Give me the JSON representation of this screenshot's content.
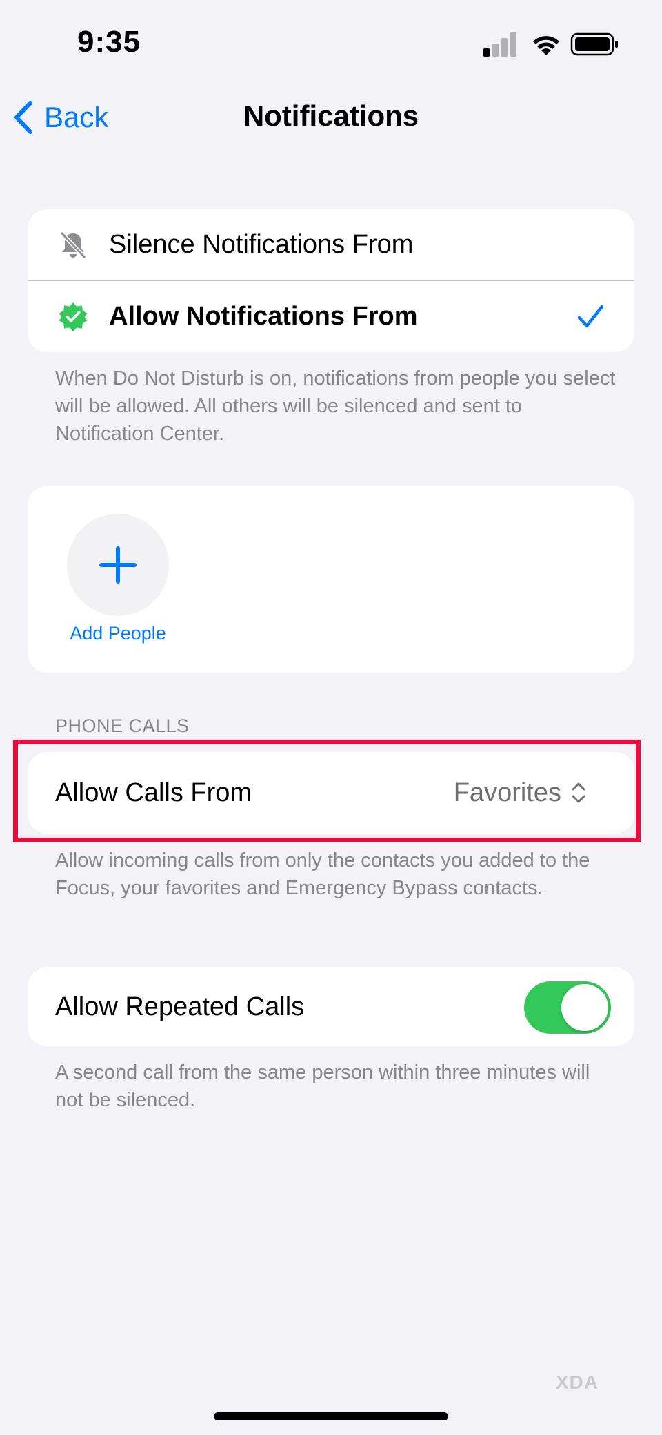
{
  "status_bar": {
    "time": "9:35",
    "icons": [
      "cellular-signal-icon",
      "wifi-icon",
      "battery-icon"
    ]
  },
  "nav": {
    "back_label": "Back",
    "title": "Notifications"
  },
  "notifications_mode": {
    "options": [
      {
        "label": "Silence Notifications From",
        "icon": "bell-slash-icon",
        "selected": false
      },
      {
        "label": "Allow Notifications From",
        "icon": "checkmark-badge-icon",
        "selected": true
      }
    ],
    "footnote": "When Do Not Disturb is on, notifications from people you select will be allowed. All others will be silenced and sent to Notification Center."
  },
  "people": {
    "add_label": "Add People"
  },
  "phone_calls": {
    "section_header": "PHONE CALLS",
    "allow_calls_label": "Allow Calls From",
    "allow_calls_value": "Favorites",
    "footnote": "Allow incoming calls from only the contacts you added to the Focus, your favorites and Emergency Bypass contacts."
  },
  "repeated_calls": {
    "label": "Allow Repeated Calls",
    "enabled": true,
    "footnote": "A second call from the same person within three minutes will not be silenced."
  },
  "watermark": "XDA",
  "colors": {
    "accent": "#007aff",
    "toggle_on": "#34c759",
    "highlight": "#e2103c",
    "background": "#f2f2f7",
    "badge_green": "#34c759"
  }
}
